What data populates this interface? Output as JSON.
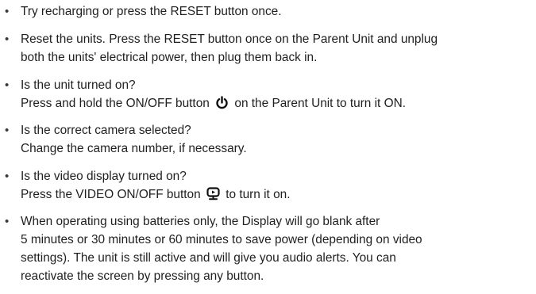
{
  "items": [
    {
      "bullet": "•",
      "lines": [
        "Try recharging or press the RESET button once."
      ]
    },
    {
      "bullet": "•",
      "lines": [
        "Reset the units. Press the RESET button once on the Parent Unit and unplug",
        "both the units' electrical power, then plug them back in."
      ]
    },
    {
      "bullet": "•",
      "lines": [
        "Is the unit turned on?"
      ],
      "line2_before": "Press and hold the ON/OFF button",
      "line2_after": "on the Parent Unit to turn it ON.",
      "line2_icon": "power-icon"
    },
    {
      "bullet": "•",
      "lines": [
        "Is the correct camera selected?",
        "Change the camera number, if necessary."
      ]
    },
    {
      "bullet": "•",
      "lines": [
        "Is the video display turned on?"
      ],
      "line2_before": "Press the VIDEO ON/OFF button",
      "line2_after": "to turn it on.",
      "line2_icon": "video-display-icon"
    },
    {
      "bullet": "•",
      "lines": [
        "When operating using batteries only, the Display will go blank after",
        "5 minutes or 30 minutes or 60 minutes to save power (depending on video",
        "settings). The unit is still active and will give you audio alerts. You can",
        "reactivate the screen by pressing any button."
      ]
    }
  ]
}
